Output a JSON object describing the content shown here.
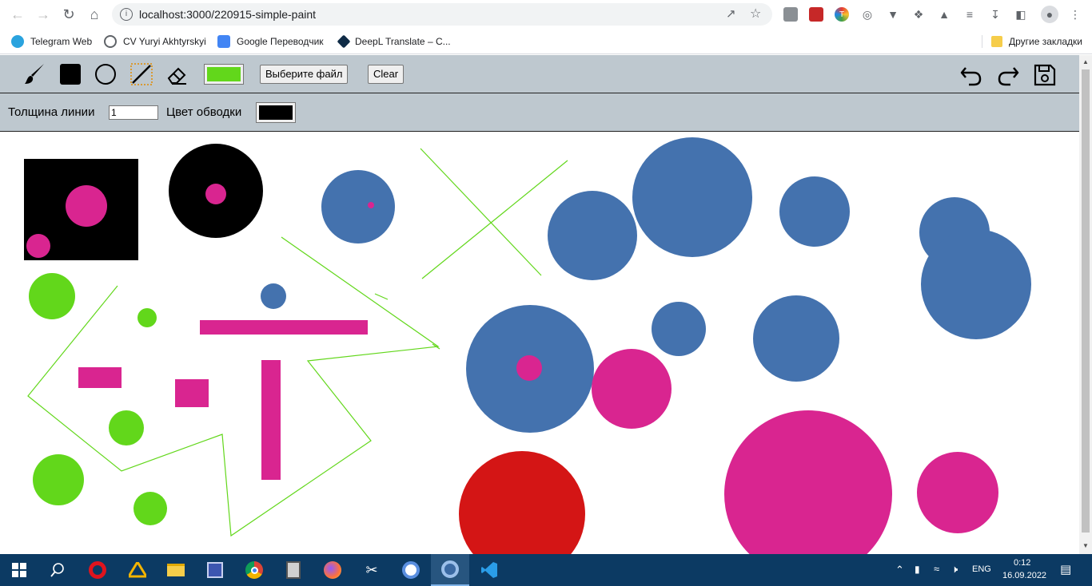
{
  "browser": {
    "url": "localhost:3000/220915-simple-paint",
    "bookmarks": [
      "Telegram Web",
      "CV Yuryi Akhtyrskyi",
      "Google Переводчик",
      "DeepL Translate – C..."
    ],
    "other_bookmarks": "Другие закладки"
  },
  "toolbar": {
    "choose_file_label": "Выберите файл",
    "clear_label": "Clear",
    "fill_color": "#62d71b",
    "line_width_label": "Толщина линии",
    "line_width_value": "1",
    "stroke_color_label": "Цвет обводки",
    "stroke_color": "#000000"
  },
  "canvas": {
    "colors": {
      "blue": "#4472ae",
      "pink": "#d92590",
      "green": "#62d71b",
      "red": "#d41515",
      "black": "#000000"
    }
  },
  "taskbar": {
    "language": "ENG",
    "time": "0:12",
    "date": "16.09.2022"
  }
}
